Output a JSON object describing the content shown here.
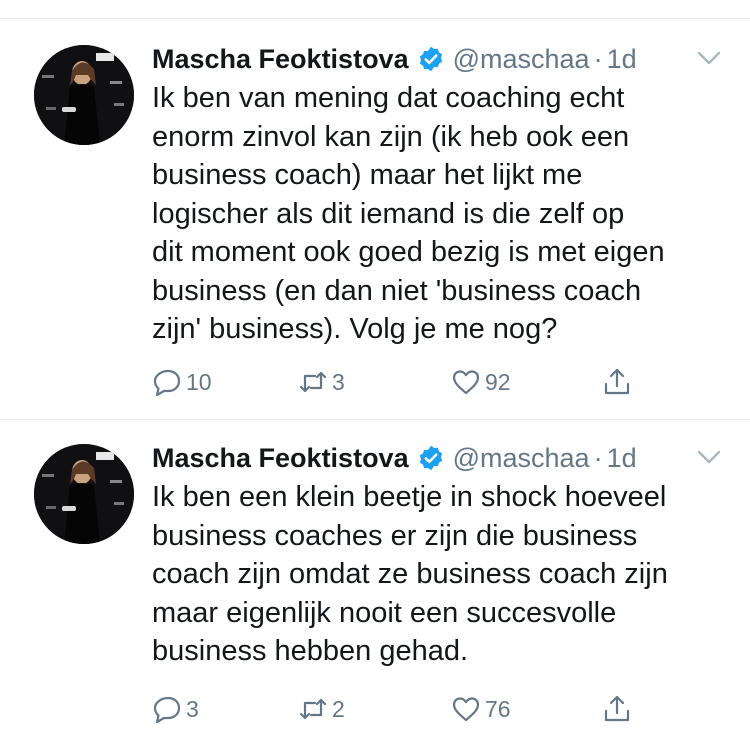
{
  "colors": {
    "text": "#14171a",
    "secondary": "#657786",
    "verified": "#1da1f2",
    "divider": "#e6ecf0"
  },
  "tweets": [
    {
      "author_name": "Mascha Feoktistova",
      "handle": "@maschaa",
      "separator": "·",
      "time": "1d",
      "text": "Ik ben van mening dat coaching echt\nenorm zinvol kan zijn (ik heb ook een\nbusiness coach) maar het lijkt me\nlogischer als dit iemand is die zelf op\ndit moment ook goed bezig is met eigen\nbusiness (en dan niet 'business coach\nzijn' business). Volg je me nog?",
      "replies": "10",
      "retweets": "3",
      "likes": "92"
    },
    {
      "author_name": "Mascha Feoktistova",
      "handle": "@maschaa",
      "separator": "·",
      "time": "1d",
      "text": "Ik ben een klein beetje in shock hoeveel\nbusiness coaches er zijn die business\ncoach zijn omdat ze business coach zijn\nmaar eigenlijk nooit een succesvolle\nbusiness hebben gehad.",
      "replies": "3",
      "retweets": "2",
      "likes": "76"
    }
  ],
  "icons": {
    "reply": "reply-icon",
    "retweet": "retweet-icon",
    "like": "heart-icon",
    "share": "share-icon",
    "verified": "verified-badge-icon",
    "more": "chevron-down-icon"
  }
}
